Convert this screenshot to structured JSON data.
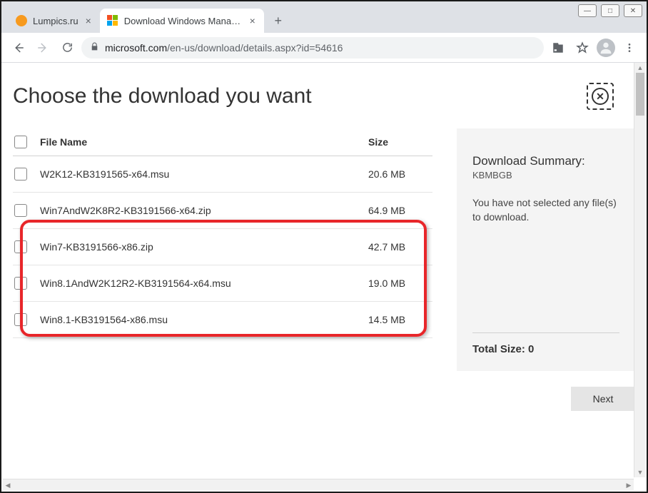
{
  "window": {
    "minimize_icon": "—",
    "maximize_icon": "□",
    "close_icon": "✕"
  },
  "tabs": [
    {
      "title": "Lumpics.ru",
      "active": false,
      "favicon_color": "#f79a1e"
    },
    {
      "title": "Download Windows Management",
      "active": true
    }
  ],
  "address_bar": {
    "domain": "microsoft.com",
    "path": "/en-us/download/details.aspx?id=54616"
  },
  "page": {
    "title": "Choose the download you want",
    "columns": {
      "filename": "File Name",
      "size": "Size"
    },
    "files": [
      {
        "name": "W2K12-KB3191565-x64.msu",
        "size": "20.6 MB"
      },
      {
        "name": "Win7AndW2K8R2-KB3191566-x64.zip",
        "size": "64.9 MB"
      },
      {
        "name": "Win7-KB3191566-x86.zip",
        "size": "42.7 MB"
      },
      {
        "name": "Win8.1AndW2K12R2-KB3191564-x64.msu",
        "size": "19.0 MB"
      },
      {
        "name": "Win8.1-KB3191564-x86.msu",
        "size": "14.5 MB"
      }
    ],
    "summary": {
      "title": "Download Summary:",
      "subtitle": "KBMBGB",
      "message": "You have not selected any file(s) to download.",
      "total_label": "Total Size: 0"
    },
    "next_button": "Next",
    "close_icon": "✕"
  }
}
